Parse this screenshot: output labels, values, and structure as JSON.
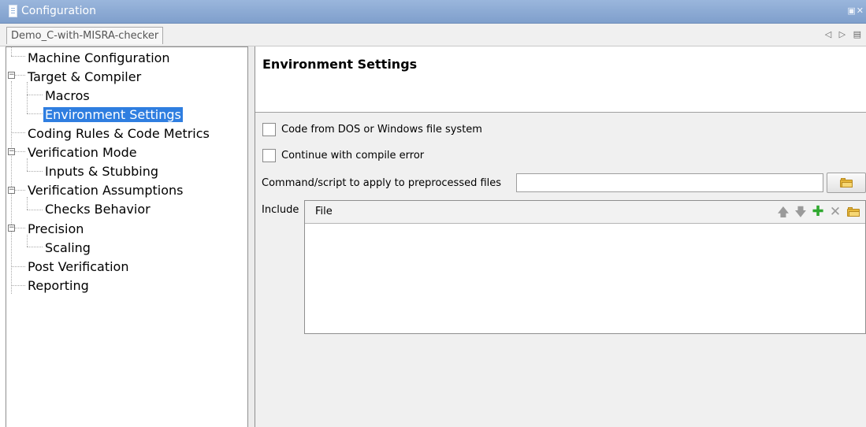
{
  "window": {
    "title": "Configuration",
    "controls": "▣✕"
  },
  "tabs": {
    "active_tab": "Demo_C-with-MISRA-checker",
    "nav": "◁ ▷ ▤"
  },
  "tree": {
    "items": [
      {
        "label": "Machine Configuration"
      },
      {
        "label": "Target & Compiler"
      },
      {
        "label": "Macros"
      },
      {
        "label": "Environment Settings",
        "selected": true
      },
      {
        "label": "Coding Rules & Code Metrics"
      },
      {
        "label": "Verification Mode"
      },
      {
        "label": "Inputs & Stubbing"
      },
      {
        "label": "Verification Assumptions"
      },
      {
        "label": "Checks Behavior"
      },
      {
        "label": "Precision"
      },
      {
        "label": "Scaling"
      },
      {
        "label": "Post Verification"
      },
      {
        "label": "Reporting"
      }
    ],
    "selection_color": "#2f7ee0"
  },
  "settings": {
    "heading": "Environment Settings",
    "dos_checkbox_label": "Code from DOS or Windows file system",
    "dos_checked": false,
    "compile_error_checkbox_label": "Continue with compile error",
    "compile_error_checked": false,
    "command_label": "Command/script to apply to preprocessed files",
    "command_value": "",
    "browse_icon": "folder-icon",
    "include_label": "Include",
    "include_table": {
      "column_header": "File",
      "rows": [],
      "tools": [
        "up-arrow-icon",
        "down-arrow-icon",
        "add-icon",
        "remove-icon",
        "folder-icon"
      ]
    }
  },
  "colors": {
    "titlebar": "#8aa9d4",
    "add_green": "#2fa82f"
  }
}
